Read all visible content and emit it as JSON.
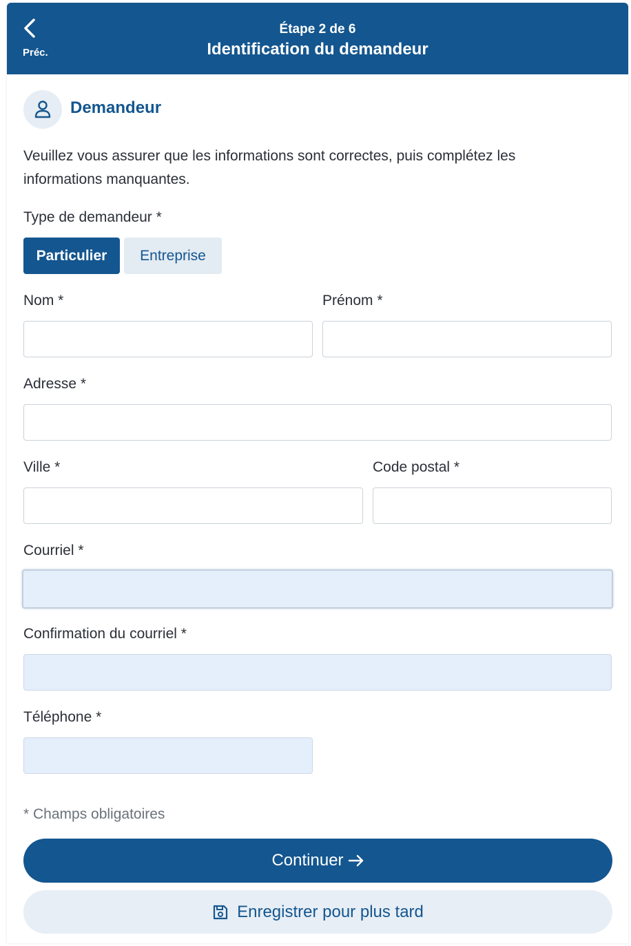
{
  "header": {
    "back_label": "Préc.",
    "step": "Étape 2 de 6",
    "title": "Identification du demandeur"
  },
  "section": {
    "icon": "user-icon",
    "title": "Demandeur"
  },
  "intro": "Veuillez vous assurer que les informations sont correctes, puis complétez les informations manquantes.",
  "applicant_type": {
    "label": "Type de demandeur *",
    "options": [
      "Particulier",
      "Entreprise"
    ],
    "selected": "Particulier"
  },
  "fields": {
    "nom": {
      "label": "Nom *",
      "value": ""
    },
    "prenom": {
      "label": "Prénom *",
      "value": ""
    },
    "adresse": {
      "label": "Adresse *",
      "value": ""
    },
    "ville": {
      "label": "Ville *",
      "value": ""
    },
    "code_postal": {
      "label": "Code postal *",
      "value": ""
    },
    "courriel": {
      "label": "Courriel *",
      "value": ""
    },
    "confirmation_courriel": {
      "label": "Confirmation du courriel *",
      "value": ""
    },
    "telephone": {
      "label": "Téléphone *",
      "value": ""
    }
  },
  "required_note": "* Champs obligatoires",
  "buttons": {
    "continue": "Continuer",
    "continue_icon": "arrow-right-icon",
    "save_later": "Enregistrer pour plus tard",
    "save_icon": "save-icon"
  },
  "colors": {
    "primary": "#14568f",
    "filled_field": "#e5eefb",
    "secondary_button": "#e7eef5"
  }
}
